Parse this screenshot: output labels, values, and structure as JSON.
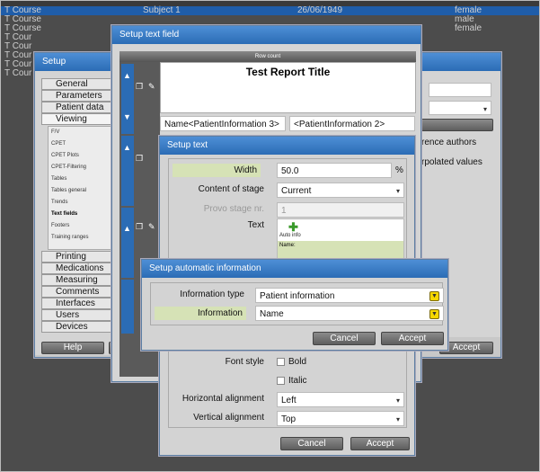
{
  "background_table": {
    "rows": [
      {
        "col1": "T Course",
        "col2": "Subject 1",
        "col3": "26/06/1949",
        "col4": "female",
        "selected": true
      },
      {
        "col1": "T Course",
        "col2": "",
        "col3": "",
        "col4": "male",
        "selected": false
      },
      {
        "col1": "T Course",
        "col2": "",
        "col3": "",
        "col4": "female",
        "selected": false
      },
      {
        "col1": "T Cour",
        "col2": "",
        "col3": "",
        "col4": "",
        "selected": false
      },
      {
        "col1": "T Cour",
        "col2": "",
        "col3": "",
        "col4": "",
        "selected": false
      },
      {
        "col1": "T Cour",
        "col2": "",
        "col3": "",
        "col4": "",
        "selected": false
      },
      {
        "col1": "T Cour",
        "col2": "",
        "col3": "",
        "col4": "",
        "selected": false
      },
      {
        "col1": "T Cour",
        "col2": "",
        "col3": "",
        "col4": "",
        "selected": false
      }
    ]
  },
  "setup": {
    "title": "Setup",
    "nav_top": [
      "General",
      "Parameters",
      "Patient data",
      "Viewing"
    ],
    "viewing_sub": [
      "F/V",
      "CPET",
      "CPET Plots",
      "CPET-Filtering",
      "Tables",
      "Tables general",
      "Trends",
      "Text fields",
      "Footers",
      "Training ranges"
    ],
    "nav_bottom": [
      "Printing",
      "Medications",
      "Measuring",
      "Comments",
      "Interfaces",
      "Users",
      "Devices"
    ],
    "help": "Help",
    "right_text_1": "rence authors",
    "right_text_2": "rpolated values",
    "accept": "Accept"
  },
  "text_field": {
    "title": "Setup text field",
    "row_count": "Row count",
    "report_title": "Test Report Title",
    "field_left": "Name<PatientInformation 3>",
    "field_right": "<PatientInformation 2>"
  },
  "setup_text": {
    "title": "Setup text",
    "width_label": "Width",
    "width_value": "50.0",
    "width_unit": "%",
    "content_label": "Content of stage",
    "content_value": "Current",
    "provo_label": "Provo stage nr.",
    "provo_value": "1",
    "text_label": "Text",
    "auto_info": "Auto info",
    "text_value": "Name:",
    "font_style_label": "Font style",
    "bold": "Bold",
    "italic": "Italic",
    "halign_label": "Horizontal alignment",
    "halign_value": "Left",
    "valign_label": "Vertical alignment",
    "valign_value": "Top",
    "cancel": "Cancel",
    "accept": "Accept"
  },
  "auto_info": {
    "title": "Setup automatic information",
    "type_label": "Information type",
    "type_value": "Patient information",
    "info_label": "Information",
    "info_value": "Name",
    "cancel": "Cancel",
    "accept": "Accept"
  }
}
